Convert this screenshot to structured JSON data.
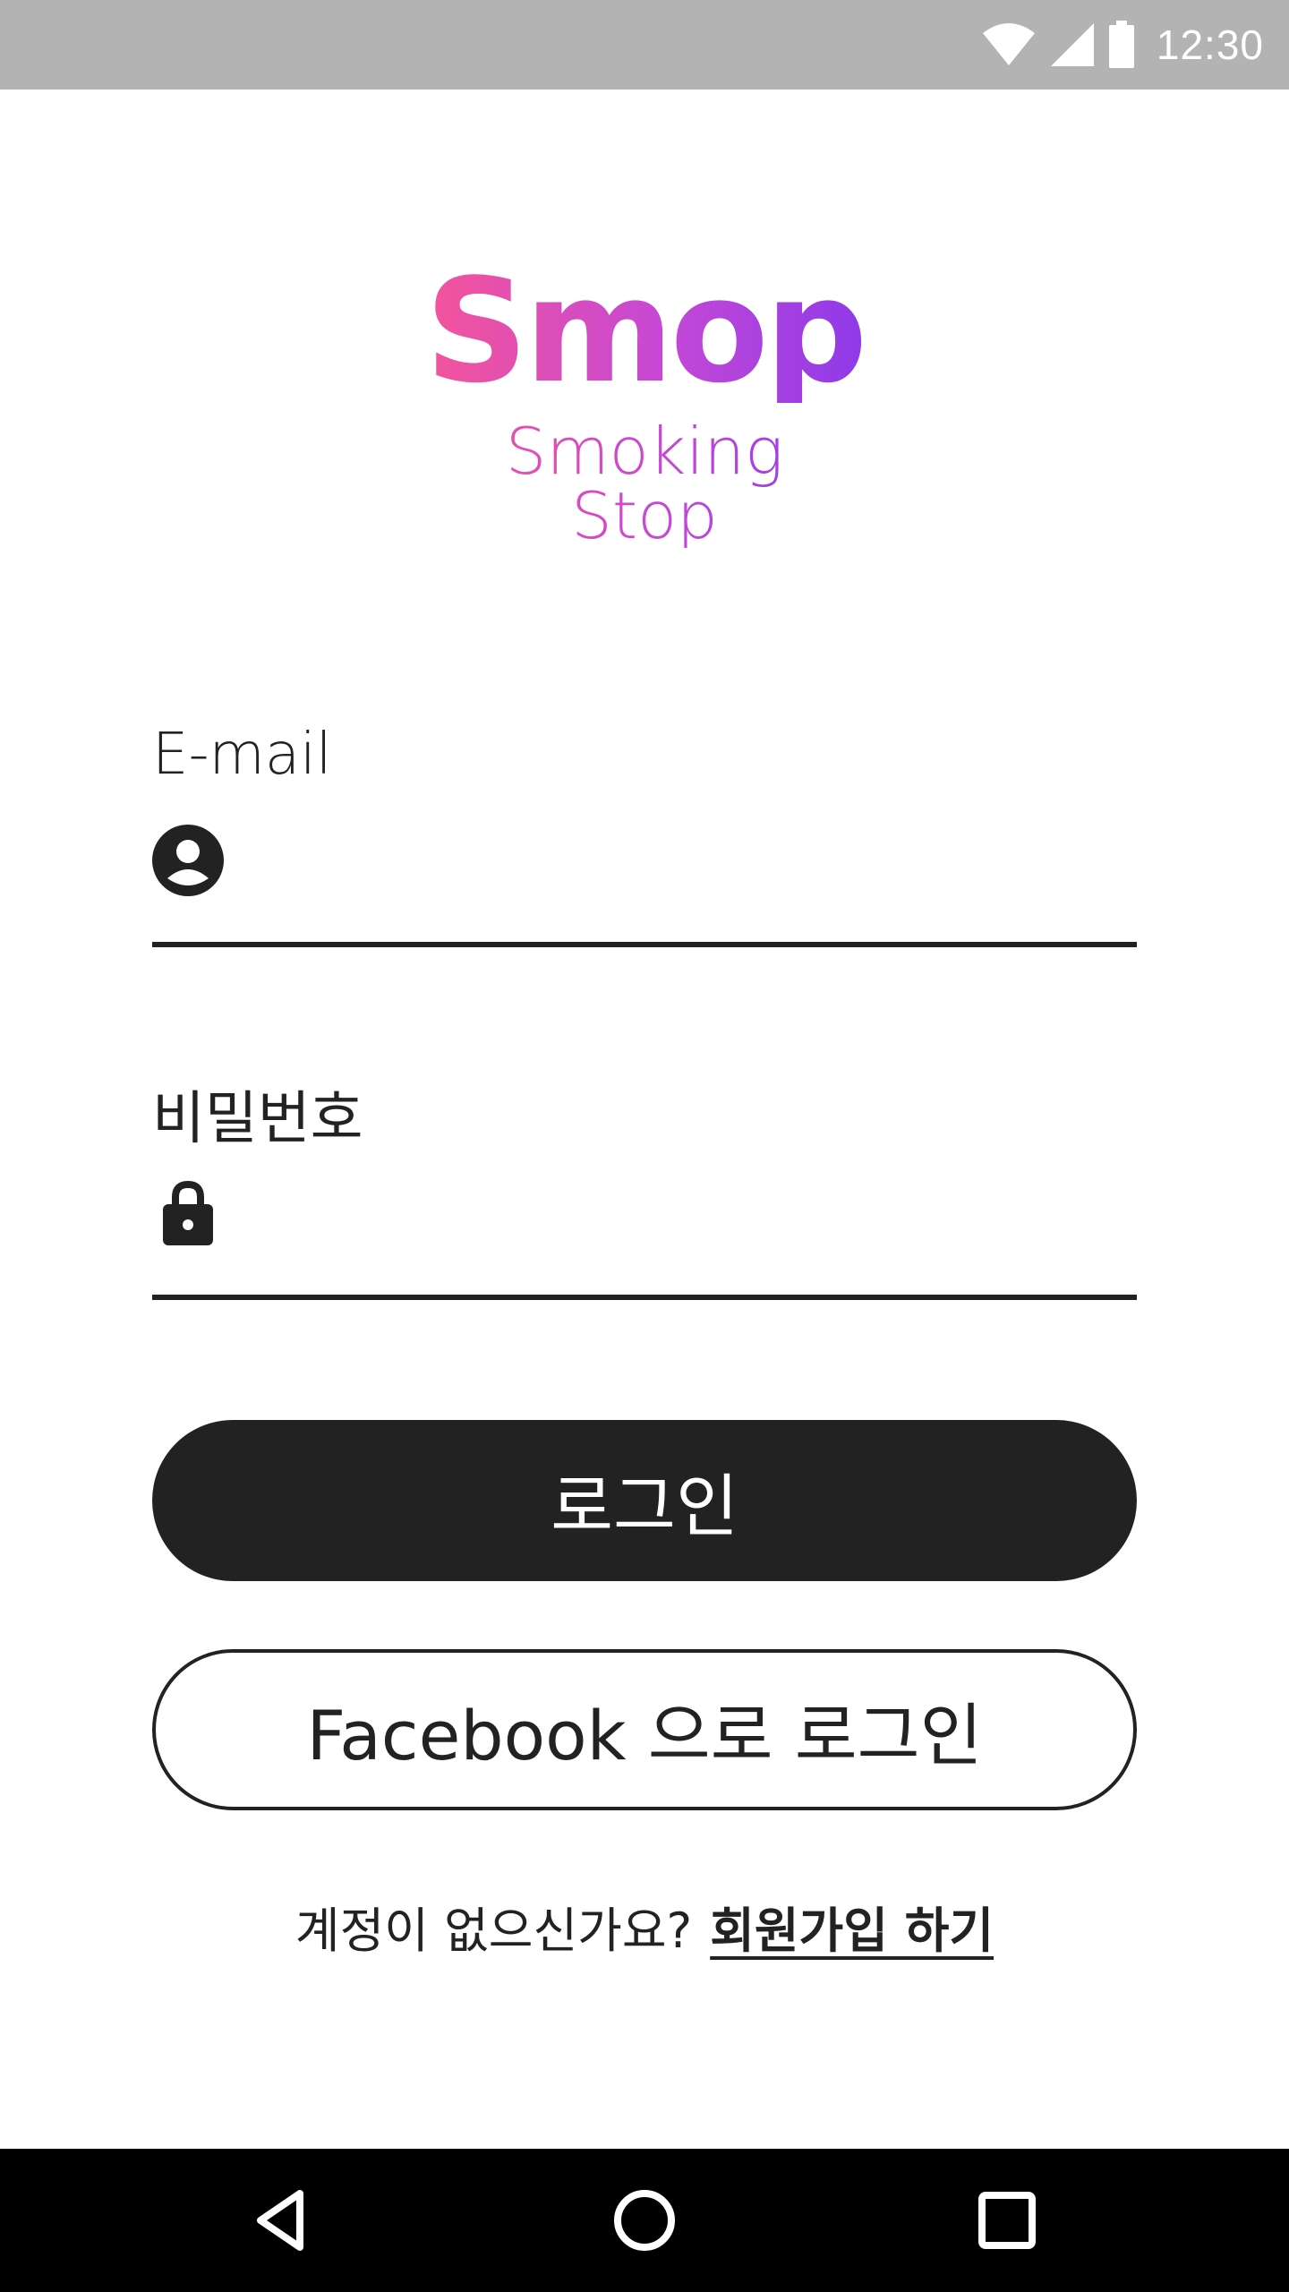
{
  "status_bar": {
    "time": "12:30",
    "icons": [
      "wifi-icon",
      "signal-icon",
      "battery-icon"
    ]
  },
  "logo": {
    "title": "Smop",
    "subtitle": "Smoking Stop",
    "gradient_colors": [
      "#f4549a",
      "#c548d6",
      "#8e3ae8"
    ]
  },
  "email_field": {
    "label": "E-mail",
    "value": "",
    "placeholder": "",
    "icon": "account-circle-icon"
  },
  "password_field": {
    "label": "비밀번호",
    "value": "",
    "placeholder": "",
    "icon": "lock-icon"
  },
  "buttons": {
    "login_label": "로그인",
    "facebook_label": "Facebook 으로 로그인"
  },
  "signup": {
    "prompt": "계정이 없으신가요?",
    "link_label": "회원가입 하기"
  },
  "nav_bar": {
    "icons": [
      "back-icon",
      "home-icon",
      "recents-icon"
    ]
  },
  "colors": {
    "primary_dark": "#222222",
    "status_bar": "#b3b3b3",
    "nav_bar": "#000000"
  }
}
